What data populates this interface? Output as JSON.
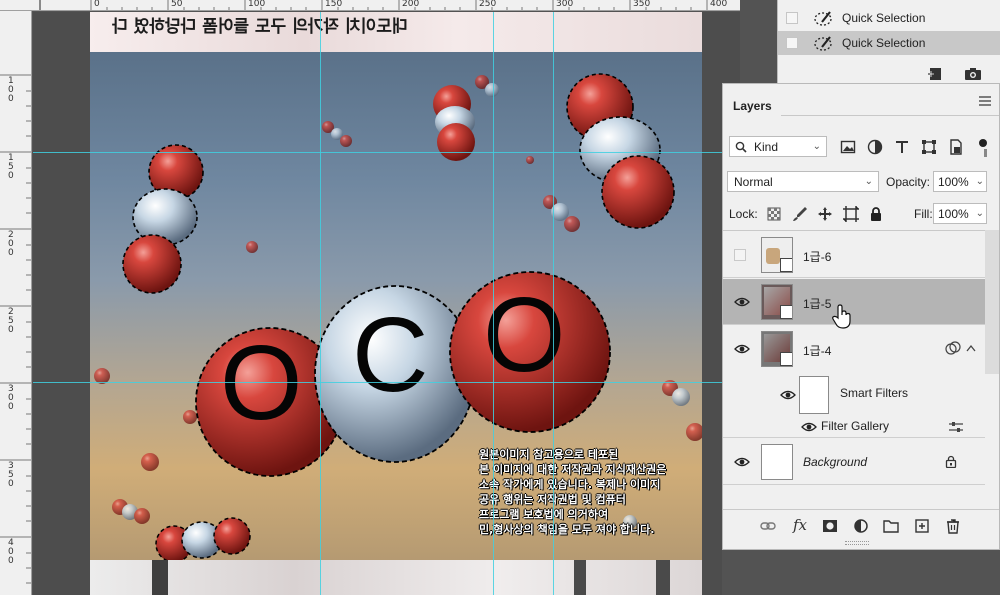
{
  "ruler": {
    "top_ticks": [
      "0",
      "50",
      "100",
      "150",
      "200",
      "250",
      "300",
      "350",
      "400"
    ],
    "left_ticks": [
      "1 0 0",
      "1 5 0",
      "2 0 0",
      "2 5 0",
      "3 0 0",
      "3 5 0",
      "4 0 0"
    ]
  },
  "canvas": {
    "mirrored_text": "대도이치 작가의 구도 들어폼 다당하였 다",
    "letters": [
      "O",
      "C",
      "O"
    ],
    "notice_lines": [
      "원본이미지 참고용으로 테포된",
      "본 이미지에 대한 저작권과 지식재산권은",
      "소속 작가에게 있습니다. 복제나 이미지",
      "공유 행위는 저작권법 및 컴퓨터",
      "프로그램 보호법에 의거하여",
      "민,형사상의 책임을 모두 져야 합니다."
    ]
  },
  "history": {
    "items": [
      {
        "label": "Quick Selection",
        "selected": false
      },
      {
        "label": "Quick Selection",
        "selected": true
      }
    ]
  },
  "layers_panel": {
    "tab": "Layers",
    "filter_kind": "Kind",
    "blend_mode": "Normal",
    "opacity_label": "Opacity:",
    "opacity_value": "100%",
    "lock_label": "Lock:",
    "fill_label": "Fill:",
    "fill_value": "100%",
    "layers": [
      {
        "name": "1급-6",
        "visible": false,
        "selected": false
      },
      {
        "name": "1급-5",
        "visible": true,
        "selected": true
      },
      {
        "name": "1급-4",
        "visible": true,
        "selected": false
      },
      {
        "name": "Smart Filters",
        "visible": true
      },
      {
        "name": "Filter Gallery",
        "visible": true
      },
      {
        "name": "Background",
        "visible": true,
        "locked": true
      }
    ]
  },
  "colors": {
    "guide": "#3fd0e0",
    "selected_layer": "#b4b4b4",
    "history_selected": "#c8c8c8",
    "molecule_red": "#cc3b32",
    "molecule_white": "#c6d4e0"
  }
}
